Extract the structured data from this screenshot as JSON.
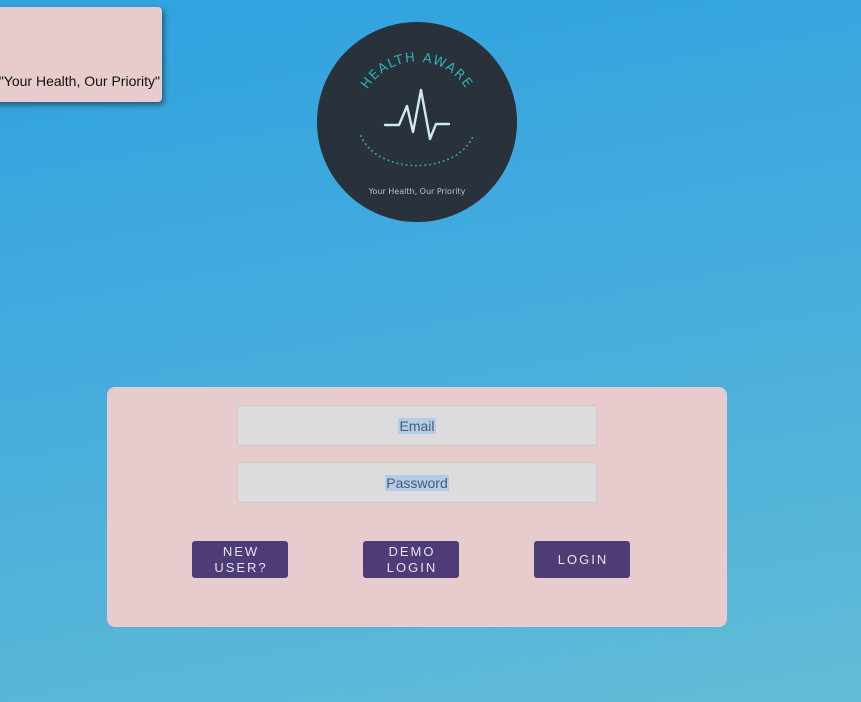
{
  "toast": {
    "message": "s. \"Your Health, Our Priority\""
  },
  "logo": {
    "brand_name": "HEALTH AWARE",
    "tagline": "Your Health, Our Priority"
  },
  "login_form": {
    "email_placeholder": "Email",
    "password_placeholder": "Password",
    "buttons": {
      "new_user": "NEW USER?",
      "demo_login": "DEMO LOGIN",
      "login": "LOGIN"
    }
  },
  "colors": {
    "background_top": "#2fa2e0",
    "background_bottom": "#62bcd6",
    "card": "#e8cbcc",
    "button": "#4d3c75",
    "logo_circle": "#29313b",
    "logo_accent": "#2bb3b8"
  }
}
